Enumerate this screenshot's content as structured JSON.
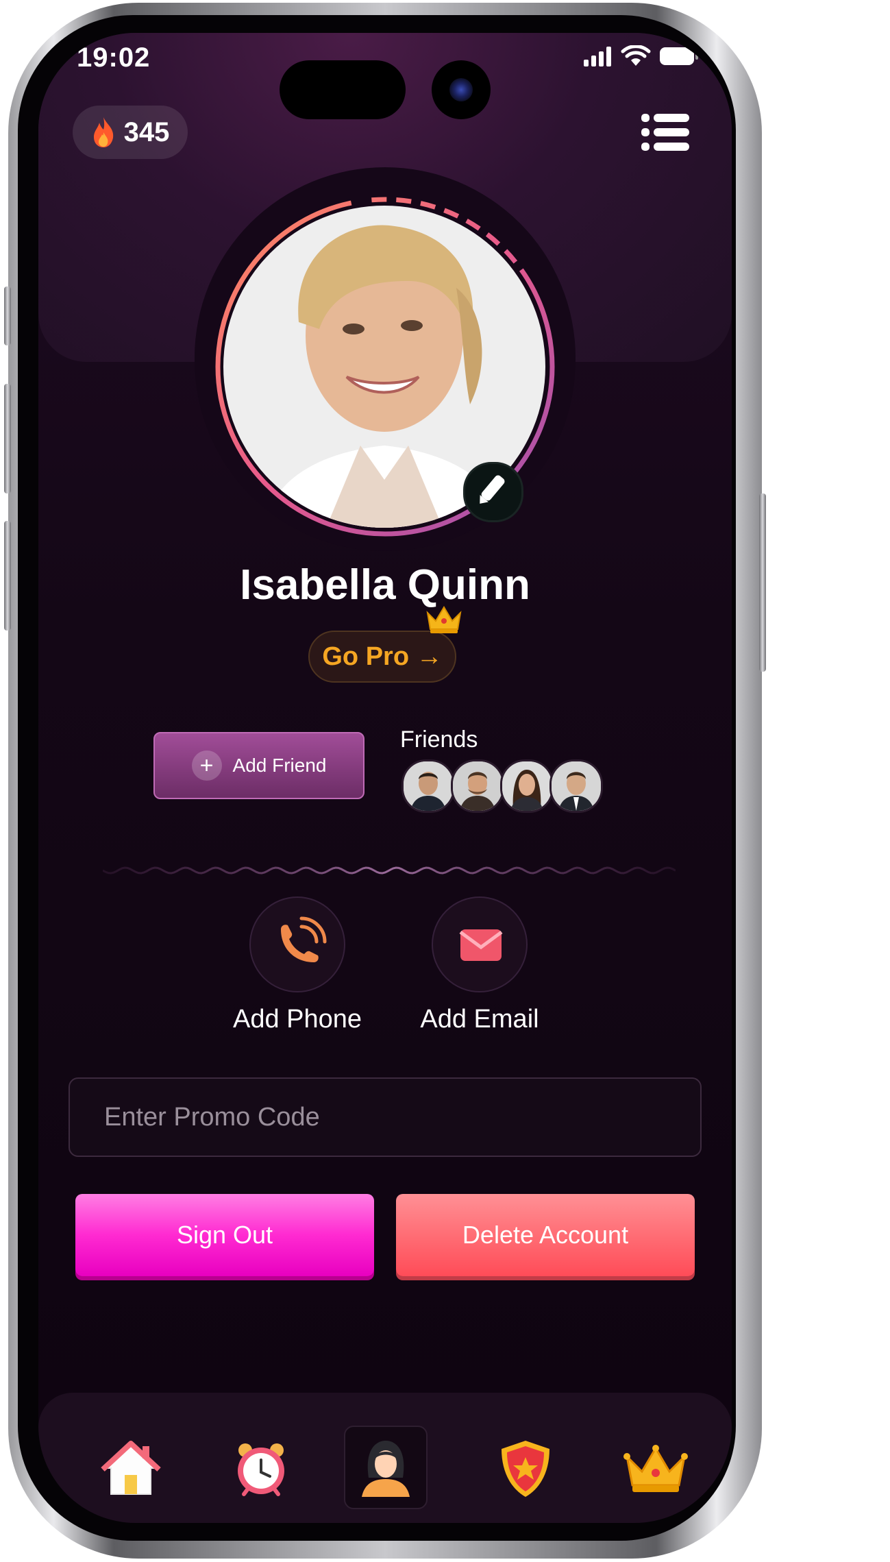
{
  "status_bar": {
    "time": "19:02"
  },
  "streak": {
    "count": "345",
    "icon": "fire-icon"
  },
  "profile": {
    "name": "Isabella Quinn",
    "go_pro_label": "Go Pro →",
    "progress_ring_fraction": 0.72
  },
  "friends": {
    "add_friend_label": "Add Friend",
    "label": "Friends",
    "avatar_count": 4
  },
  "actions": {
    "add_phone_label": "Add Phone",
    "add_email_label": "Add Email"
  },
  "promo": {
    "placeholder": "Enter Promo Code"
  },
  "buttons": {
    "sign_out_label": "Sign Out",
    "delete_account_label": "Delete Account"
  },
  "tab_bar": {
    "items": [
      {
        "icon": "home-icon",
        "active": false
      },
      {
        "icon": "alarm-clock-icon",
        "active": false
      },
      {
        "icon": "profile-icon",
        "active": true
      },
      {
        "icon": "shield-icon",
        "active": false
      },
      {
        "icon": "crown-icon",
        "active": false
      }
    ]
  },
  "colors": {
    "accent_pink": "#ff2ad1",
    "accent_red": "#ff6a72",
    "pro_gold": "#f5a623",
    "background": "#140716"
  }
}
